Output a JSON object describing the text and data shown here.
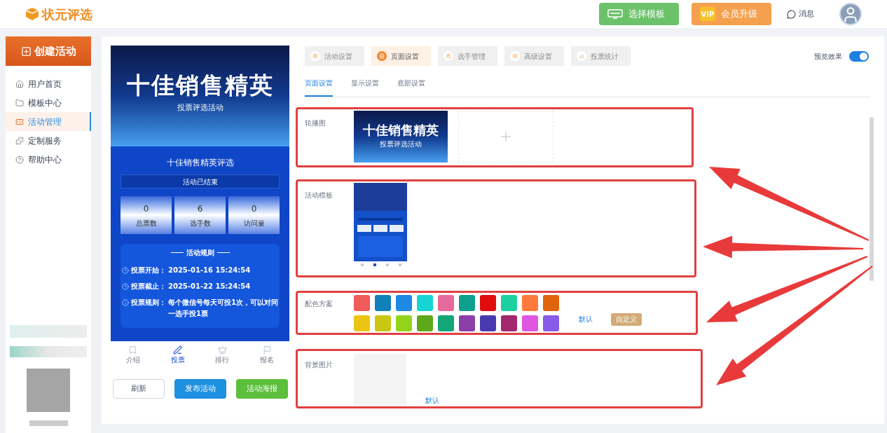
{
  "header": {
    "logo_text": "状元评选",
    "buttons": [
      {
        "label": "选择模板",
        "kind": "template"
      },
      {
        "label": "会员升级",
        "kind": "vip"
      }
    ],
    "vip_badge": "VIP",
    "messages": "消息"
  },
  "sidebar": {
    "create_button": "创建活动",
    "items": [
      {
        "label": "用户首页",
        "selected": false
      },
      {
        "label": "模板中心",
        "selected": false
      },
      {
        "label": "活动管理",
        "selected": true
      },
      {
        "label": "定制服务",
        "selected": false
      },
      {
        "label": "帮助中心",
        "selected": false
      }
    ]
  },
  "preview": {
    "banner_title": "十佳销售精英",
    "banner_subtitle": "投票评选活动",
    "activity_name": "十佳销售精英评选",
    "status": "活动已结束",
    "stats": [
      {
        "value": "0",
        "label": "总票数"
      },
      {
        "value": "6",
        "label": "选手数"
      },
      {
        "value": "0",
        "label": "访问量"
      }
    ],
    "rules_title": "活动规则",
    "rules": [
      {
        "kind": "clock",
        "label": "投票开始：",
        "value": "2025-01-16 15:24:54"
      },
      {
        "kind": "clock",
        "label": "投票截止：",
        "value": "2025-01-22 15:24:54"
      },
      {
        "kind": "info",
        "label": "投票规则：",
        "value": "每个微信号每天可投1次，可以对同一选手投1票"
      }
    ],
    "nav": [
      {
        "label": "介绍",
        "selected": false
      },
      {
        "label": "投票",
        "selected": true
      },
      {
        "label": "排行",
        "selected": false
      },
      {
        "label": "报名",
        "selected": false
      }
    ],
    "buttons": [
      {
        "label": "刷新",
        "kind": "plain"
      },
      {
        "label": "发布活动",
        "kind": "primary"
      },
      {
        "label": "活动海报",
        "kind": "success"
      }
    ]
  },
  "settings": {
    "tabs": [
      {
        "label": "活动设置",
        "selected": false
      },
      {
        "label": "页面设置",
        "selected": true
      },
      {
        "label": "选手管理",
        "selected": false
      },
      {
        "label": "高级设置",
        "selected": false
      },
      {
        "label": "投票统计",
        "selected": false
      }
    ],
    "preview_toggle": {
      "label": "预览效果",
      "on": true
    },
    "subtabs": [
      {
        "label": "页面设置",
        "selected": true
      },
      {
        "label": "显示设置",
        "selected": false
      },
      {
        "label": "底部设置",
        "selected": false
      }
    ],
    "carousel": {
      "label": "轮播图",
      "thumb_title": "十佳销售精英",
      "thumb_subtitle": "投票评选活动"
    },
    "template": {
      "label": "活动模板"
    },
    "colors": {
      "label": "配色方案",
      "default_link": "默认",
      "custom_button": "自定义",
      "swatches": [
        {
          "color": "#f05a5a"
        },
        {
          "color": "#1180b8"
        },
        {
          "color": "#1e88e5"
        },
        {
          "color": "#16d4d4"
        },
        {
          "color": "#e56b9b"
        },
        {
          "color": "#0e9f8f"
        },
        {
          "color": "#e00d0d"
        },
        {
          "color": "#1ecfa0"
        },
        {
          "color": "#ff7b3d"
        },
        {
          "color": "#e0640c"
        },
        {
          "color": "#ecc514"
        },
        {
          "color": "#cbc612"
        },
        {
          "color": "#93d41a"
        },
        {
          "color": "#5fa81a"
        },
        {
          "color": "#12a679"
        },
        {
          "color": "#8b3fa8"
        },
        {
          "color": "#4a3ab0"
        },
        {
          "color": "#a3286e"
        },
        {
          "color": "#e056e0"
        },
        {
          "color": "#8a5ae8"
        }
      ]
    },
    "background": {
      "label": "背景图片",
      "default_link": "默认"
    }
  }
}
